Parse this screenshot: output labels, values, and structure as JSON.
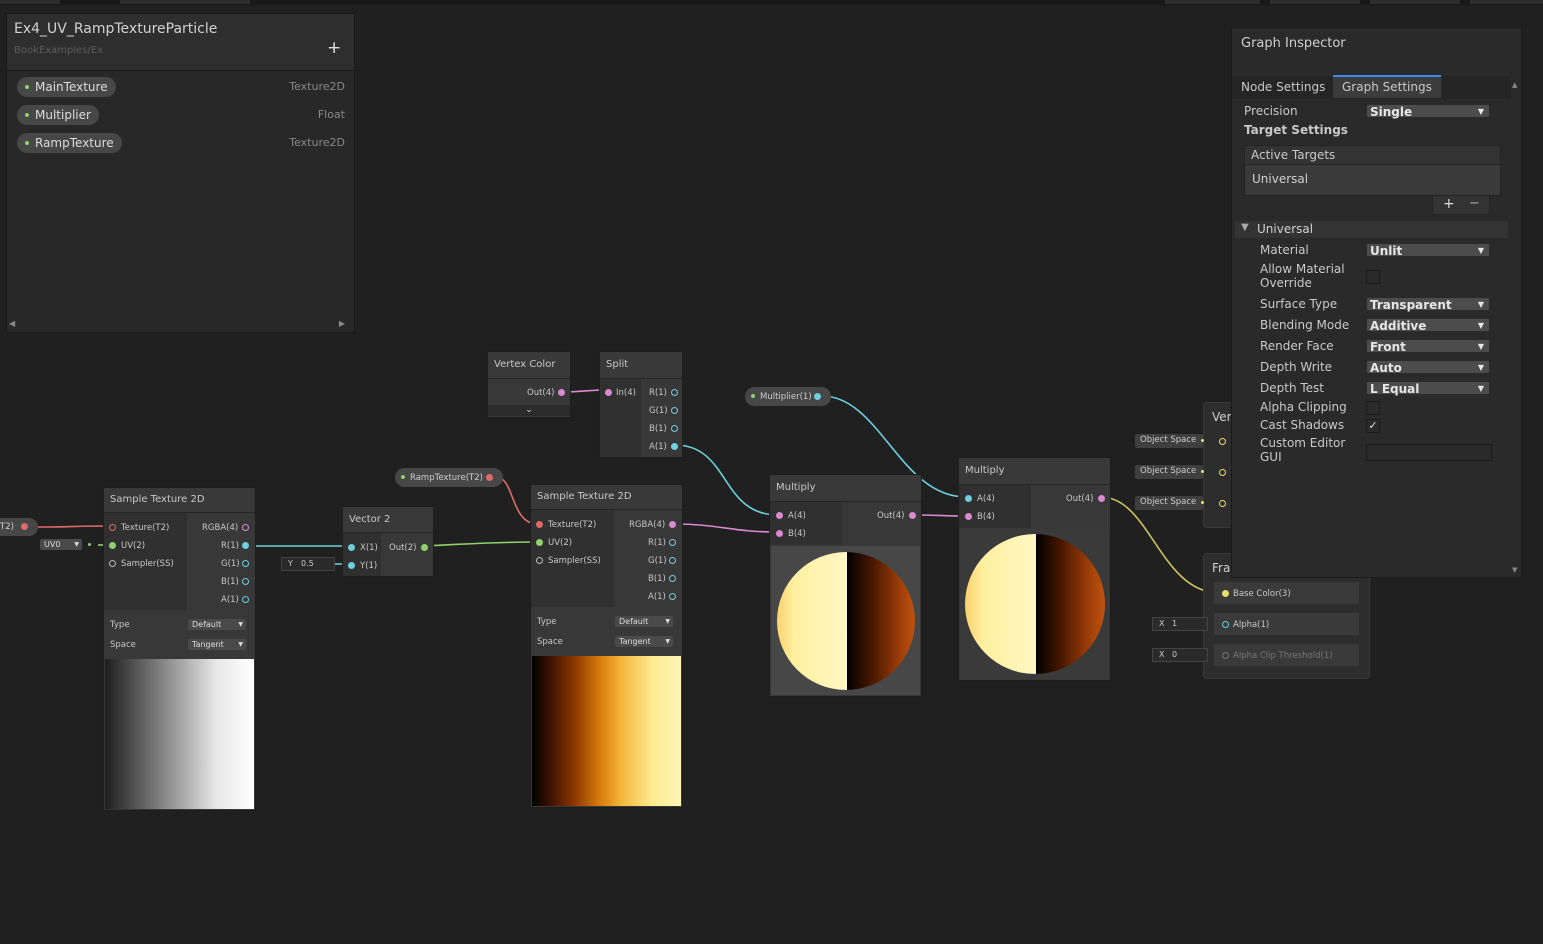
{
  "blackboard": {
    "title": "Ex4_UV_RampTextureParticle",
    "path": "BookExamples/Ex",
    "add_label": "+",
    "properties": [
      {
        "name": "MainTexture",
        "type": "Texture2D"
      },
      {
        "name": "Multiplier",
        "type": "Float"
      },
      {
        "name": "RampTexture",
        "type": "Texture2D"
      }
    ]
  },
  "offscreen_texture_port": "T2)",
  "uv_dropdown": "UV0",
  "sample_texture_1": {
    "title": "Sample Texture 2D",
    "inputs": [
      "Texture(T2)",
      "UV(2)",
      "Sampler(SS)"
    ],
    "outputs": [
      "RGBA(4)",
      "R(1)",
      "G(1)",
      "B(1)",
      "A(1)"
    ],
    "type_label": "Type",
    "type_value": "Default",
    "space_label": "Space",
    "space_value": "Tangent"
  },
  "vector2": {
    "title": "Vector 2",
    "inputs": [
      "X(1)",
      "Y(1)"
    ],
    "output": "Out(2)",
    "y_field_label": "Y",
    "y_value": "0.5"
  },
  "ramp_texture_property": "RampTexture(T2)",
  "sample_texture_2": {
    "title": "Sample Texture 2D",
    "inputs": [
      "Texture(T2)",
      "UV(2)",
      "Sampler(SS)"
    ],
    "outputs": [
      "RGBA(4)",
      "R(1)",
      "G(1)",
      "B(1)",
      "A(1)"
    ],
    "type_label": "Type",
    "type_value": "Default",
    "space_label": "Space",
    "space_value": "Tangent"
  },
  "vertex_color": {
    "title": "Vertex Color",
    "output": "Out(4)"
  },
  "split": {
    "title": "Split",
    "input": "In(4)",
    "outputs": [
      "R(1)",
      "G(1)",
      "B(1)",
      "A(1)"
    ]
  },
  "multiplier_property": "Multiplier(1)",
  "multiply_1": {
    "title": "Multiply",
    "inputs": [
      "A(4)",
      "B(4)"
    ],
    "output": "Out(4)"
  },
  "multiply_2": {
    "title": "Multiply",
    "inputs": [
      "A(4)",
      "B(4)"
    ],
    "output": "Out(4)"
  },
  "vertex_block": {
    "title": "Ver",
    "inputs": [
      "Object Space",
      "Object Space",
      "Object Space"
    ]
  },
  "fragment_block": {
    "title": "Fra",
    "ports": [
      "Base Color(3)",
      "Alpha(1)",
      "Alpha Clip Threshold(1)"
    ],
    "alpha_field_label": "X",
    "alpha_value": "1",
    "clip_field_label": "X",
    "clip_value": "0"
  },
  "inspector": {
    "title": "Graph Inspector",
    "tabs": [
      "Node Settings",
      "Graph Settings"
    ],
    "precision_label": "Precision",
    "precision_value": "Single",
    "target_settings_label": "Target Settings",
    "active_targets_label": "Active Targets",
    "active_target": "Universal",
    "add_label": "+",
    "remove_label": "−",
    "section_title": "Universal",
    "settings": [
      {
        "label": "Material",
        "value": "Unlit"
      },
      {
        "label": "Allow Material Override",
        "checked": false
      },
      {
        "label": "Surface Type",
        "value": "Transparent"
      },
      {
        "label": "Blending Mode",
        "value": "Additive"
      },
      {
        "label": "Render Face",
        "value": "Front"
      },
      {
        "label": "Depth Write",
        "value": "Auto"
      },
      {
        "label": "Depth Test",
        "value": "L Equal"
      },
      {
        "label": "Alpha Clipping",
        "checked": false
      },
      {
        "label": "Cast Shadows",
        "checked": true
      },
      {
        "label": "Custom Editor GUI",
        "value": ""
      }
    ]
  },
  "colors": {
    "canvas": "#202020",
    "texture_wire": "#e06a6a",
    "float_wire": "#6ecfe0",
    "vector2_wire": "#8fd16d",
    "vector4_wire": "#d98ad0",
    "vector3_wire": "#e8e06c",
    "accent": "#3b8ce6"
  }
}
